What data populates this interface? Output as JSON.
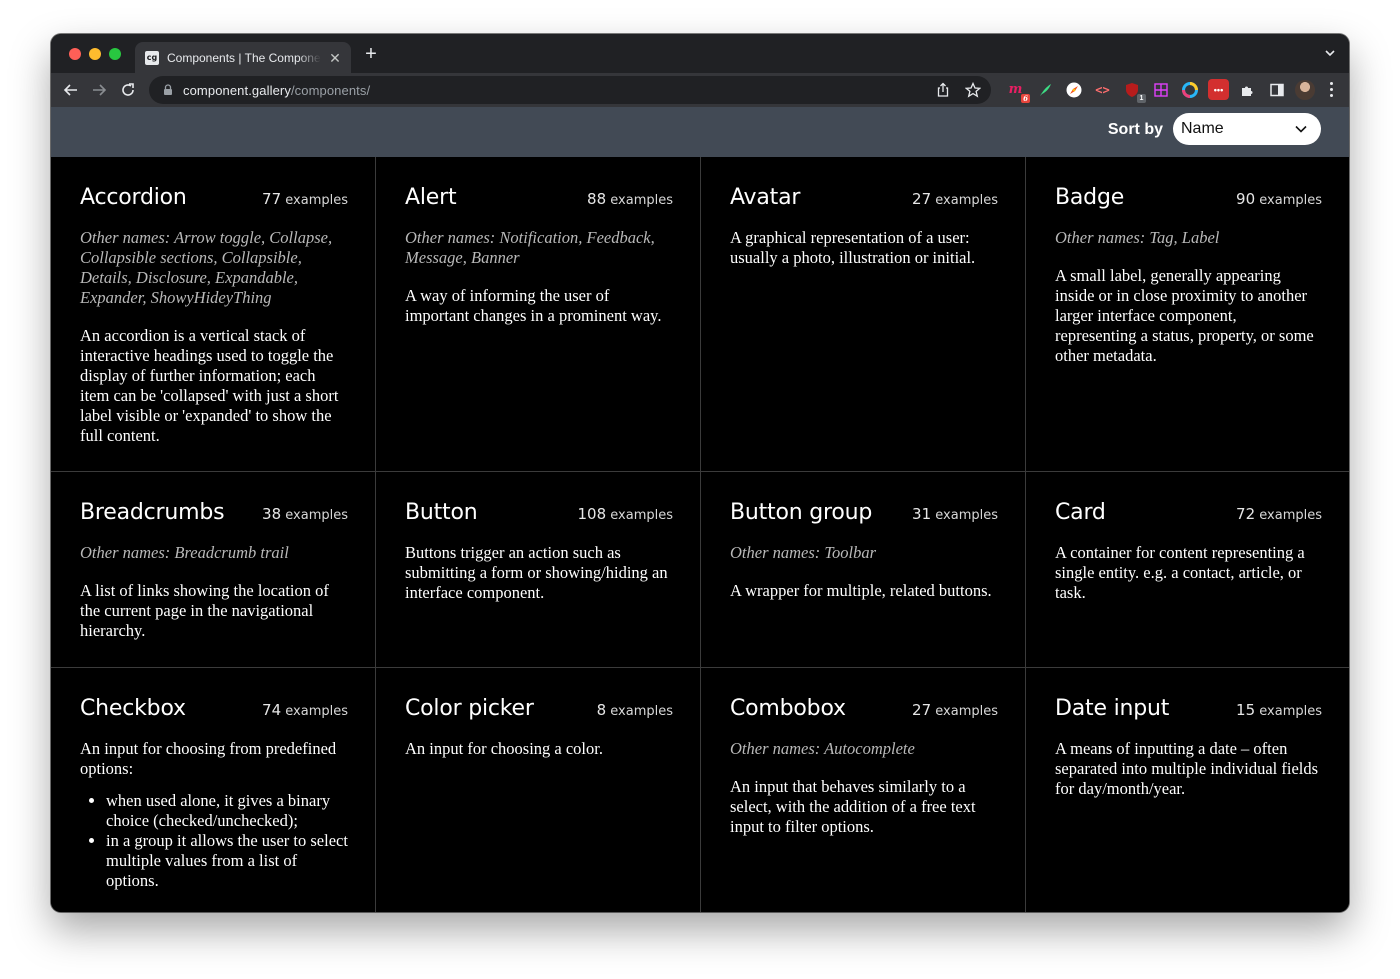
{
  "browser": {
    "tab_title": "Components | The Component Gallery",
    "favicon_text": "cg",
    "url_host": "component.gallery",
    "url_path": "/components/",
    "extensions": [
      {
        "icon": "mozbar-icon",
        "label": "m",
        "color": "#c1185b",
        "badge": "6"
      },
      {
        "icon": "feather-icon",
        "label": "",
        "color": "#35363a",
        "badge": ""
      },
      {
        "icon": "compass-icon",
        "label": "",
        "color": "#35363a",
        "badge": ""
      },
      {
        "icon": "code-icon",
        "label": "<>",
        "color": "#35363a",
        "badge": ""
      },
      {
        "icon": "ublock-icon",
        "label": "uo",
        "color": "#8b0000",
        "badge": "1"
      },
      {
        "icon": "grid-icon",
        "label": "#",
        "color": "#35363a",
        "badge": ""
      },
      {
        "icon": "color-ring-icon",
        "label": "",
        "color": "#35363a",
        "badge": ""
      },
      {
        "icon": "ellipsis-ext-icon",
        "label": "•••",
        "color": "#d32f2f",
        "badge": ""
      }
    ]
  },
  "header": {
    "sort_label": "Sort by",
    "sort_value": "Name"
  },
  "components": [
    {
      "title": "Accordion",
      "count": "77",
      "count_suffix": "examples",
      "other_names": "Other names: Arrow toggle, Collapse, Collapsible sections, Collapsible, Details, Disclosure, Expandable, Expander, ShowyHideyThing",
      "description": "An accordion is a vertical stack of interactive headings used to toggle the display of further information; each item can be 'collapsed' with just a short label visible or 'expanded' to show the full content."
    },
    {
      "title": "Alert",
      "count": "88",
      "count_suffix": "examples",
      "other_names": "Other names: Notification, Feedback, Message, Banner",
      "description": "A way of informing the user of important changes in a prominent way."
    },
    {
      "title": "Avatar",
      "count": "27",
      "count_suffix": "examples",
      "other_names": "",
      "description": "A graphical representation of a user: usually a photo, illustration or initial."
    },
    {
      "title": "Badge",
      "count": "90",
      "count_suffix": "examples",
      "other_names": "Other names: Tag, Label",
      "description": "A small label, generally appearing inside or in close proximity to another larger interface component, representing a status, property, or some other metadata."
    },
    {
      "title": "Breadcrumbs",
      "count": "38",
      "count_suffix": "examples",
      "other_names": "Other names: Breadcrumb trail",
      "description": "A list of links showing the location of the current page in the navigational hierarchy."
    },
    {
      "title": "Button",
      "count": "108",
      "count_suffix": "examples",
      "other_names": "",
      "description": "Buttons trigger an action such as submitting a form or showing/hiding an interface component."
    },
    {
      "title": "Button group",
      "count": "31",
      "count_suffix": "examples",
      "other_names": "Other names: Toolbar",
      "description": "A wrapper for multiple, related buttons."
    },
    {
      "title": "Card",
      "count": "72",
      "count_suffix": "examples",
      "other_names": "",
      "description": "A container for content representing a single entity. e.g. a contact, article, or task."
    },
    {
      "title": "Checkbox",
      "count": "74",
      "count_suffix": "examples",
      "other_names": "",
      "description": "An input for choosing from predefined options:",
      "bullets": [
        "when used alone, it gives a binary choice (checked/unchecked);",
        "in a group it allows the user to select multiple values from a list of options."
      ]
    },
    {
      "title": "Color picker",
      "count": "8",
      "count_suffix": "examples",
      "other_names": "",
      "description": "An input for choosing a color."
    },
    {
      "title": "Combobox",
      "count": "27",
      "count_suffix": "examples",
      "other_names": "Other names: Autocomplete",
      "description": "An input that behaves similarly to a select, with the addition of a free text input to filter options."
    },
    {
      "title": "Date input",
      "count": "15",
      "count_suffix": "examples",
      "other_names": "",
      "description": "A means of inputting a date – often separated into multiple individual fields for day/month/year."
    }
  ]
}
